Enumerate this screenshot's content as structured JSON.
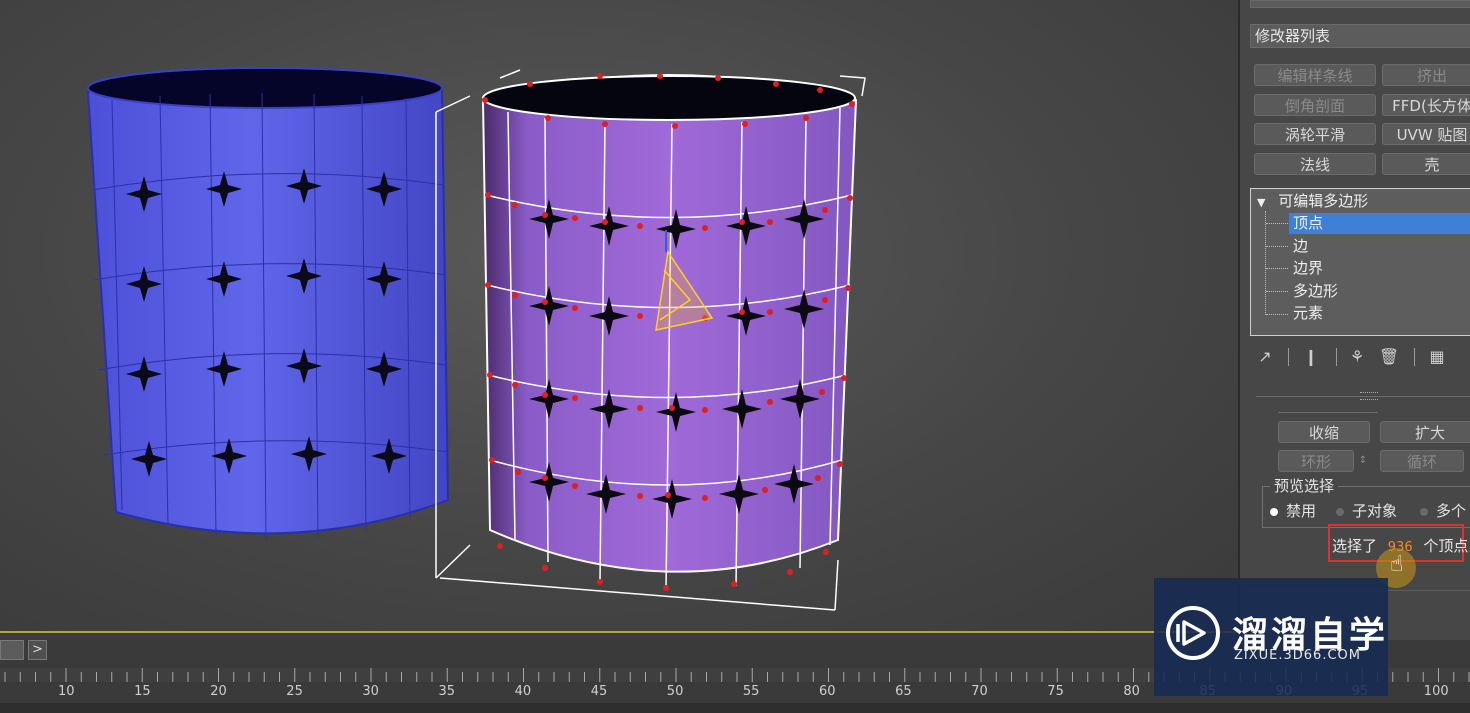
{
  "panel": {
    "modifier_list_label": "修改器列表",
    "buttons": [
      {
        "label": "编辑样条线",
        "enabled": false
      },
      {
        "label": "挤出",
        "enabled": false
      },
      {
        "label": "倒角剖面",
        "enabled": false
      },
      {
        "label": "FFD(长方体",
        "enabled": true
      },
      {
        "label": "涡轮平滑",
        "enabled": true
      },
      {
        "label": "UVW 贴图",
        "enabled": true
      },
      {
        "label": "法线",
        "enabled": true
      },
      {
        "label": "壳",
        "enabled": true
      }
    ],
    "stack": {
      "root": "可编辑多边形",
      "expand_glyph": "▼",
      "items": [
        "顶点",
        "边",
        "边界",
        "多边形",
        "元素"
      ],
      "selected": "顶点"
    },
    "tools": [
      "pin-icon",
      "show-end-result-icon",
      "make-unique-icon",
      "remove-modifier-icon",
      "configure-sets-icon"
    ],
    "selection": {
      "shrink_label": "收缩",
      "grow_label": "扩大",
      "ring_label": "环形",
      "loop_label": "循环",
      "preview_title": "预览选择",
      "preview_options": [
        "禁用",
        "子对象",
        "多个"
      ],
      "preview_selected": "禁用",
      "selected_prefix": "选择了",
      "selected_count": "936",
      "selected_suffix": "个顶点"
    }
  },
  "timeline": {
    "next_glyph": ">",
    "ticks": [
      "10",
      "15",
      "20",
      "25",
      "30",
      "35",
      "40",
      "45",
      "50",
      "55",
      "60",
      "65",
      "70",
      "75",
      "80",
      "85",
      "90",
      "95",
      "100"
    ]
  },
  "watermark": {
    "title": "溜溜自学",
    "url": "ZIXUE.3D66.COM"
  },
  "colors": {
    "blue_object": "#5a5fe0",
    "purple_object": "#9966d4",
    "highlight_box": "#e03030",
    "count_color": "#ff8a1a",
    "selected_row": "#3f7fd6"
  }
}
